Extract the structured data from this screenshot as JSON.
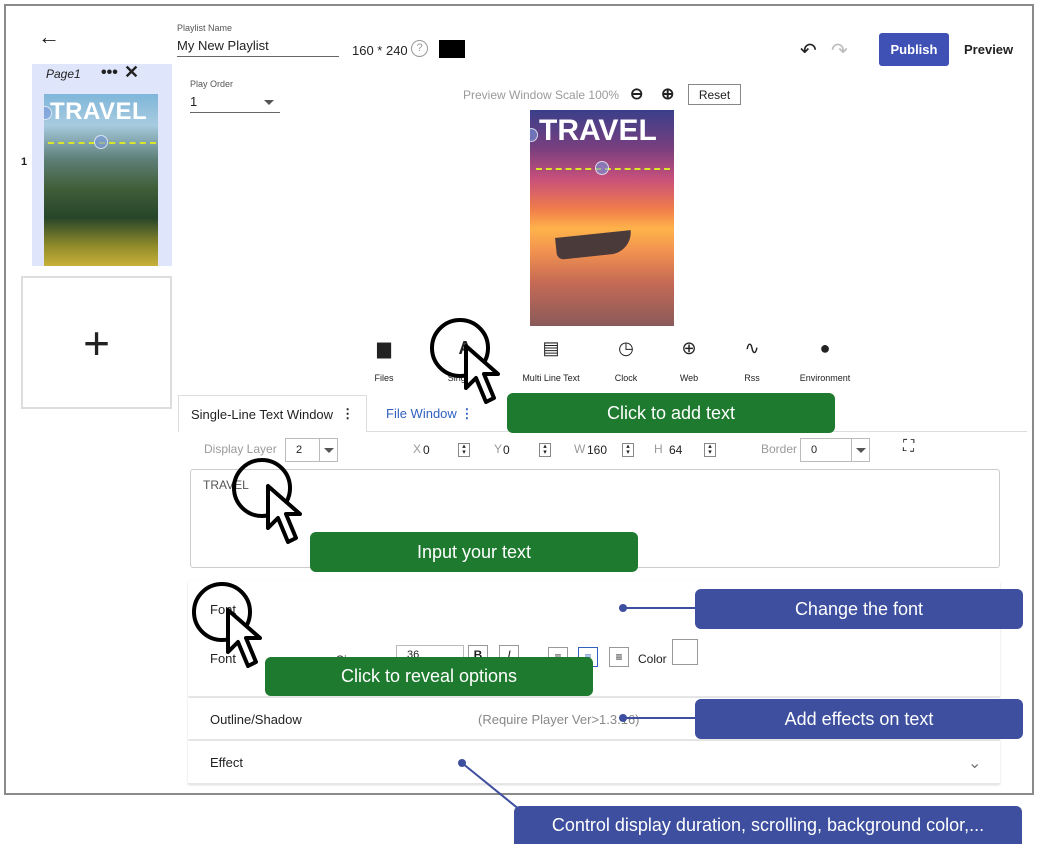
{
  "header": {
    "playlist_name_label": "Playlist Name",
    "playlist_name_value": "My New Playlist",
    "resolution": "160 * 240",
    "help_icon": "?",
    "bg_color": "#000000",
    "publish_label": "Publish",
    "preview_label": "Preview",
    "back_icon": "←",
    "undo_icon": "↶",
    "redo_icon": "↷"
  },
  "play_order": {
    "label": "Play Order",
    "value": "1"
  },
  "pages": [
    {
      "label": "Page1",
      "thumb_title": "TRAVEL",
      "number": "1",
      "more_icon": "•••",
      "close_icon": "✕"
    }
  ],
  "add_page_icon": "+",
  "preview": {
    "scale_label": "Preview Window Scale",
    "scale_value": "100%",
    "reset_label": "Reset",
    "title": "TRAVEL",
    "zoom_out_icon": "⊖",
    "zoom_in_icon": "⊕"
  },
  "toolbar": [
    {
      "label": "Files",
      "icon": "folder-icon",
      "glyph": "▆"
    },
    {
      "label": "Single Li",
      "icon": "text-icon",
      "glyph": "A"
    },
    {
      "label": "Multi Line Text",
      "icon": "document-icon",
      "glyph": "▤"
    },
    {
      "label": "Clock",
      "icon": "clock-icon",
      "glyph": "◷"
    },
    {
      "label": "Web",
      "icon": "globe-icon",
      "glyph": "⊕"
    },
    {
      "label": "Rss",
      "icon": "rss-icon",
      "glyph": "∿"
    },
    {
      "label": "Environment",
      "icon": "environment-icon",
      "glyph": "●"
    }
  ],
  "tabs": {
    "active": "Single-Line Text Window",
    "other": "File Window",
    "more_icon": "⋮"
  },
  "controls": {
    "display_layer_label": "Display Layer",
    "display_layer_value": "2",
    "x_label": "X",
    "x_value": "0",
    "y_label": "Y",
    "y_value": "0",
    "w_label": "W",
    "w_value": "160",
    "h_label": "H",
    "h_value": "64",
    "border_label": "Border",
    "border_value": "0",
    "fullscreen_icon": "⛶"
  },
  "text_input": {
    "value": "TRAVEL"
  },
  "font_panel": {
    "title": "Font",
    "font_label": "Font",
    "size_prefix": "Si",
    "size_value": "36",
    "bold": "B",
    "italic": "I",
    "color_label": "Color"
  },
  "outline_panel": {
    "title": "Outline/Shadow",
    "note": "(Require Player Ver>1.3.16)"
  },
  "effect_panel": {
    "title": "Effect",
    "chevron": "⌄"
  },
  "callouts": {
    "add_text": "Click to add text",
    "input_text": "Input your text",
    "reveal": "Click to reveal options",
    "font": "Change the font",
    "effects": "Add effects on text",
    "control": "Control display duration, scrolling, background color,..."
  },
  "colors": {
    "accent": "#3f51b5",
    "callout_green": "#1e7a2e",
    "callout_blue": "#3d4f9e"
  }
}
